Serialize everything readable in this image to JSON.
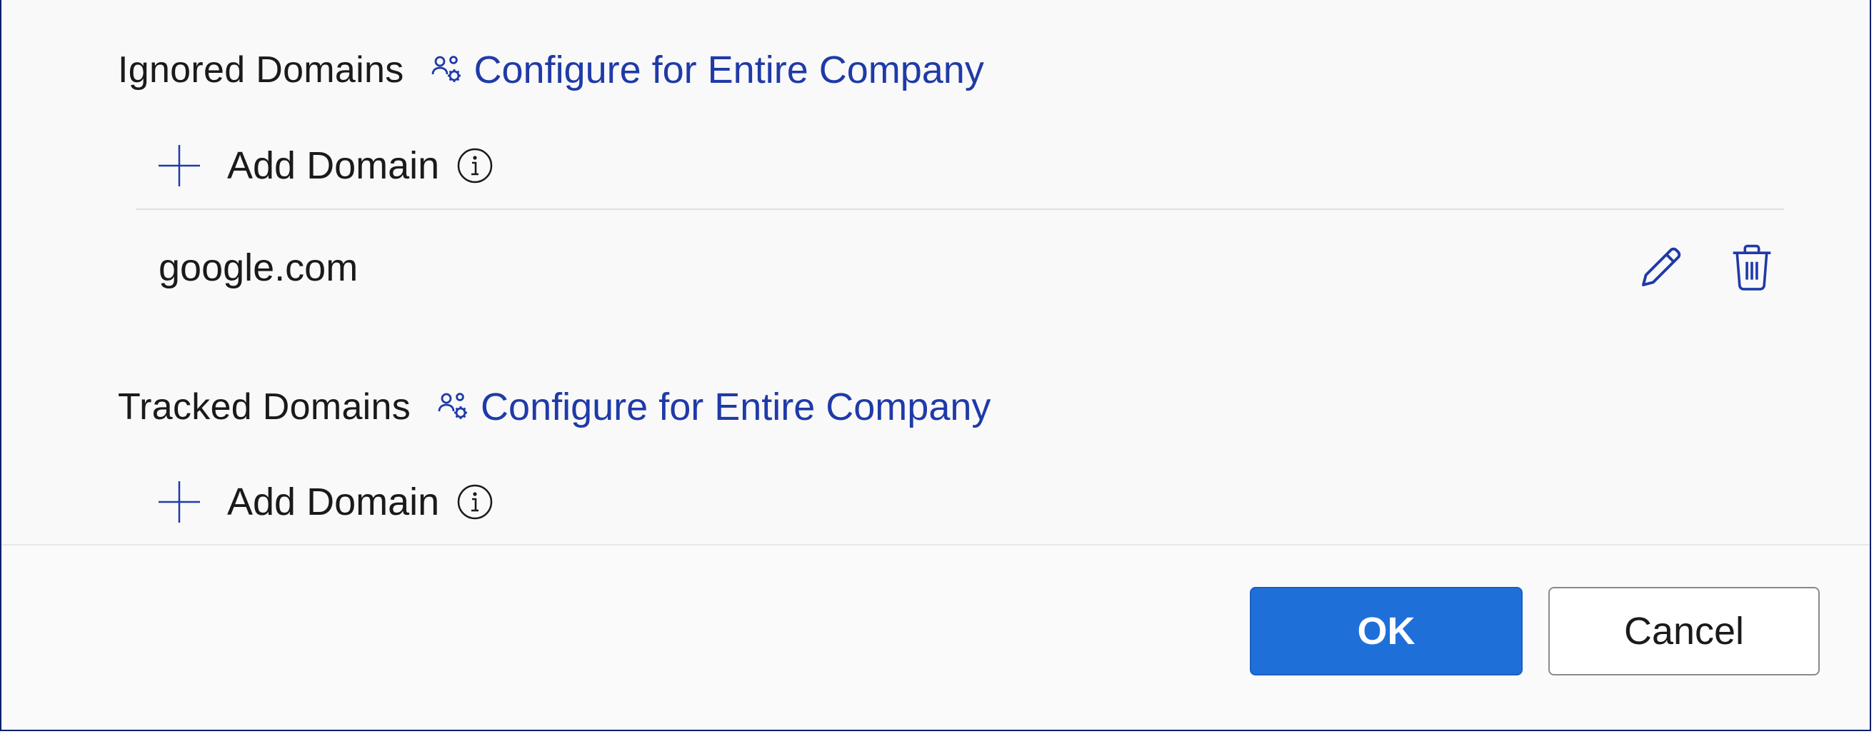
{
  "ignored": {
    "title": "Ignored Domains",
    "config_link": "Configure for Entire Company",
    "add_label": "Add Domain",
    "domains": [
      "google.com"
    ]
  },
  "tracked": {
    "title": "Tracked Domains",
    "config_link": "Configure for Entire Company",
    "add_label": "Add Domain"
  },
  "footer": {
    "ok_label": "OK",
    "cancel_label": "Cancel"
  },
  "icons": {
    "config": "people-gear-icon",
    "add": "plus-icon",
    "info": "info-icon",
    "edit": "pencil-icon",
    "delete": "trash-icon"
  },
  "colors": {
    "link": "#1f3aa8",
    "primary": "#1f6fd9",
    "text": "#1a1a1a"
  }
}
